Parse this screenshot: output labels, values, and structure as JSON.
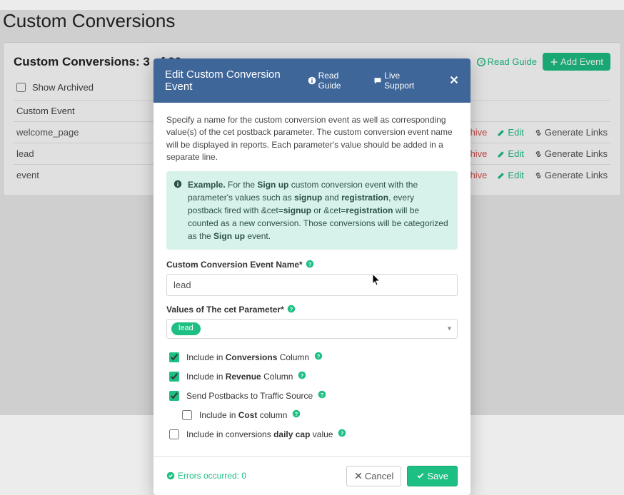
{
  "page": {
    "title": "Custom Conversions"
  },
  "panel": {
    "heading": "Custom Conversions: 3 of 20",
    "read_guide": "Read Guide",
    "add_event": "Add Event",
    "show_archived": "Show Archived",
    "col_event": "Custom Event",
    "rows": [
      {
        "name": "welcome_page"
      },
      {
        "name": "lead"
      },
      {
        "name": "event"
      }
    ],
    "act_archive": "Archive",
    "act_edit": "Edit",
    "act_generate": "Generate Links"
  },
  "modal": {
    "title": "Edit Custom Conversion Event",
    "read_guide": "Read Guide",
    "live_support": "Live Support",
    "desc": "Specify a name for the custom conversion event as well as corresponding value(s) of the cet postback parameter. The custom conversion event name will be displayed in reports. Each parameter's value should be added in a separate line.",
    "example_lead": "Example.",
    "example_t1": " For the ",
    "example_b1": "Sign up",
    "example_t2": " custom conversion event with the parameter's values such as ",
    "example_b2": "signup",
    "example_t3": " and ",
    "example_b3": "registration",
    "example_t4": ", every postback fired with &cet=",
    "example_b4": "signup",
    "example_t5": " or &cet=",
    "example_b5": "registration",
    "example_t6": " will be counted as a new conversion. Those conversions will be categorized as the ",
    "example_b6": "Sign up",
    "example_t7": " event.",
    "label_name": "Custom Conversion Event Name*",
    "input_name": "lead",
    "label_values": "Values of The cet Parameter*",
    "tag1": "lead",
    "cb1_pre": "Include in ",
    "cb1_bold": "Conversions",
    "cb1_post": " Column",
    "cb2_pre": "Include in ",
    "cb2_bold": "Revenue",
    "cb2_post": " Column",
    "cb3": "Send Postbacks to Traffic Source",
    "cb4_pre": "Include in ",
    "cb4_bold": "Cost",
    "cb4_post": " column",
    "cb5_pre": "Include in conversions ",
    "cb5_bold": "daily cap",
    "cb5_post": " value",
    "errors": "Errors occurred: 0",
    "cancel": "Cancel",
    "save": "Save"
  }
}
